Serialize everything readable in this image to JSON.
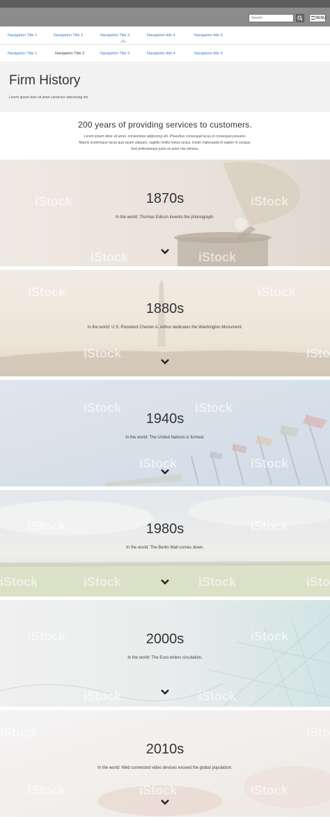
{
  "utility": {
    "search_placeholder": "Search",
    "search_button_icon": "search-icon",
    "menu_label": "MENU"
  },
  "nav_primary": [
    {
      "label": "Navigation Title 1"
    },
    {
      "label": "Navigation Title 2"
    },
    {
      "label": "Navigation Title 3"
    },
    {
      "label": "Navigation title 4"
    },
    {
      "label": "Navigation title 5"
    }
  ],
  "nav_secondary": [
    {
      "label": "Navigation Title 1"
    },
    {
      "label": "Navigation Title 2"
    },
    {
      "label": "Navigation Title 3"
    },
    {
      "label": "Navigation title 4"
    },
    {
      "label": "Navigation title 5"
    }
  ],
  "header": {
    "title": "Firm History",
    "subtitle": "Lorem ipsum dolo sit amet carsectur adsciscing ets"
  },
  "intro": {
    "heading": "200 years of providing services to customers.",
    "lines": [
      "Lorem ipsum dolor sit amet, consectetur adipiscing elit. Phasellus consequat lacus id consequat posuere.",
      "Mauris scelerisque lacus quis quam aliquam, sagittis mollis metus luctus. Etiam malesuada id sapien in congue.",
      "Sed pellentesque justo sit amet nisi ultricies."
    ]
  },
  "eras": [
    {
      "decade": "1870s",
      "text": "In the world: Thomas Edison invents the phonograph."
    },
    {
      "decade": "1880s",
      "text": "In the world: U.S. President Chester A. Arthur dedicates the Washington Monument."
    },
    {
      "decade": "1940s",
      "text": "In the world: The United Nations is formed."
    },
    {
      "decade": "1980s",
      "text": "In the world: The Berlin Wall comes down."
    },
    {
      "decade": "2000s",
      "text": "In the world: The Euro enters circulation."
    },
    {
      "decade": "2010s",
      "text": "In the world: Web connected video devices exceed the global population."
    }
  ],
  "watermark": "iStock",
  "colors": {
    "link": "#3a7cc0",
    "topbar": "#8c8c8c",
    "header_bg": "#f2f2f2"
  }
}
